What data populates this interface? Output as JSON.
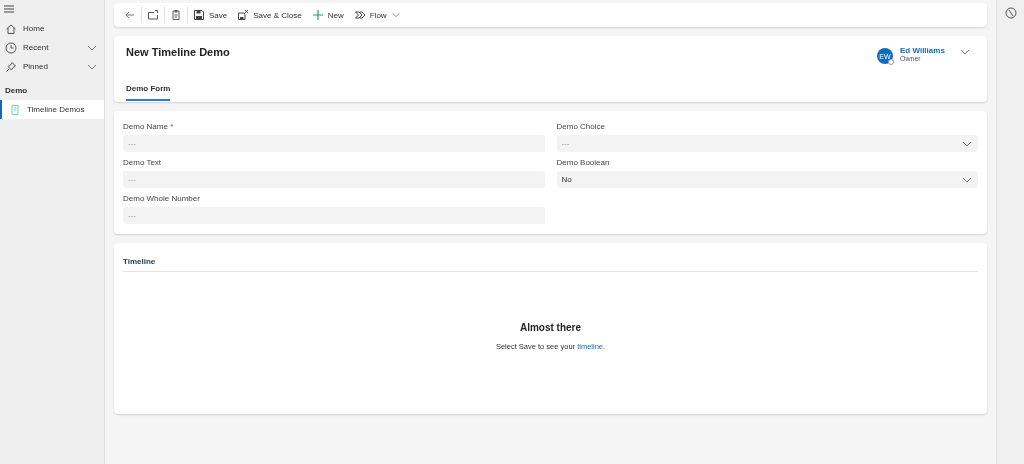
{
  "sidebar": {
    "items": [
      {
        "label": "Home",
        "kind": "link"
      },
      {
        "label": "Recent",
        "kind": "group"
      },
      {
        "label": "Pinned",
        "kind": "group"
      }
    ],
    "group": "Demo",
    "group_items": [
      {
        "label": "Timeline Demos",
        "selected": true
      }
    ]
  },
  "toolbar": [
    {
      "kind": "icon"
    },
    {
      "kind": "icon"
    },
    {
      "kind": "icon"
    },
    {
      "kind": "button",
      "label": "Save"
    },
    {
      "kind": "button",
      "label": "Save & Close"
    },
    {
      "kind": "button",
      "label": "New"
    },
    {
      "kind": "menu",
      "label": "Flow"
    }
  ],
  "header": {
    "title": "New Timeline Demo",
    "owner": {
      "initials": "EW",
      "name": "Ed Williams",
      "role": "Owner"
    },
    "tabs": [
      {
        "label": "Demo Form",
        "selected": true
      }
    ]
  },
  "form": {
    "columns": [
      [
        {
          "label": "Demo Name",
          "required_mark": "*",
          "kind": "text",
          "placeholder": "---"
        },
        {
          "label": "Demo Text",
          "kind": "text",
          "placeholder": "---"
        },
        {
          "label": "Demo Whole Number",
          "kind": "text",
          "placeholder": "---"
        }
      ],
      [
        {
          "label": "Demo Choice",
          "kind": "dropdown",
          "placeholder": "---"
        },
        {
          "label": "Demo Boolean",
          "kind": "dropdown",
          "value": "No"
        }
      ]
    ]
  },
  "timeline": {
    "title": "Timeline",
    "heading": "Almost there",
    "message_before": "Select Save to see your ",
    "link": "timeline",
    "message_after": "."
  }
}
